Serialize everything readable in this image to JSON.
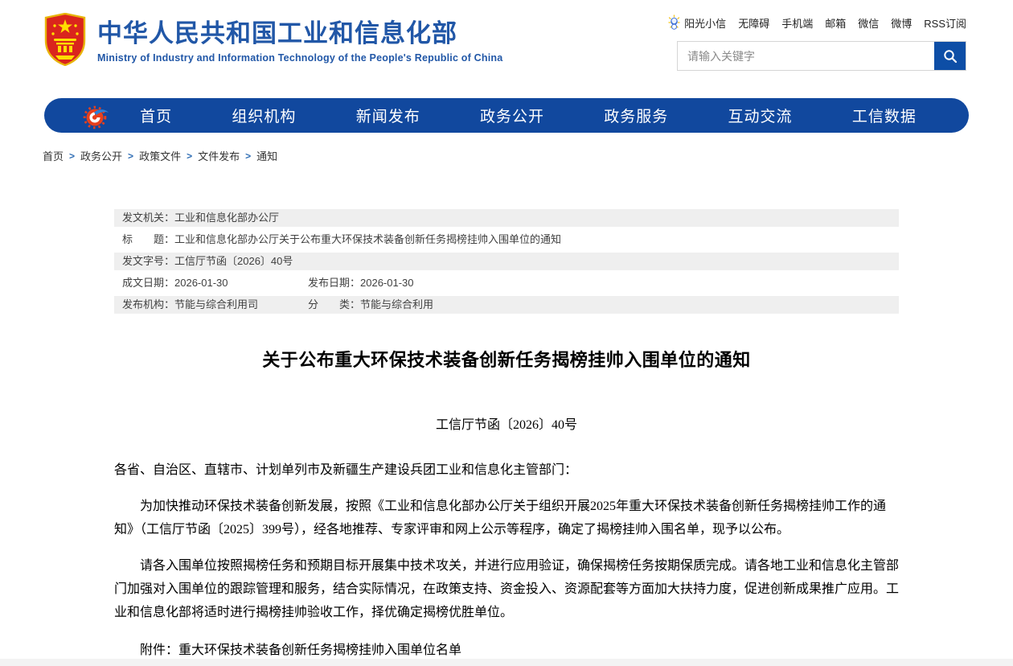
{
  "header": {
    "site_title": "中华人民共和国工业和信息化部",
    "site_subtitle": "Ministry of Industry and Information Technology of the People's Republic of China",
    "top_links": [
      "阳光小信",
      "无障碍",
      "手机端",
      "邮箱",
      "微信",
      "微博",
      "RSS订阅"
    ],
    "search": {
      "placeholder": "请输入关键字"
    }
  },
  "nav": {
    "items": [
      "首页",
      "组织机构",
      "新闻发布",
      "政务公开",
      "政务服务",
      "互动交流",
      "工信数据"
    ]
  },
  "breadcrumb": {
    "separator": ">",
    "items": [
      "首页",
      "政务公开",
      "政策文件",
      "文件发布",
      "通知"
    ]
  },
  "meta_table": {
    "rows": [
      {
        "label1": "发文机关：",
        "value1": "工业和信息化部办公厅",
        "label2": "",
        "value2": ""
      },
      {
        "label1": "标　　题：",
        "value1": "工业和信息化部办公厅关于公布重大环保技术装备创新任务揭榜挂帅入围单位的通知",
        "label2": "",
        "value2": ""
      },
      {
        "label1": "发文字号：",
        "value1": "工信厅节函〔2026〕40号",
        "label2": "",
        "value2": ""
      },
      {
        "label1": "成文日期：",
        "value1": "2026-01-30",
        "label2": "发布日期：",
        "value2": "2026-01-30"
      },
      {
        "label1": "发布机构：",
        "value1": "节能与综合利用司",
        "label2": "分　　类：",
        "value2": "节能与综合利用"
      }
    ]
  },
  "article": {
    "title": "关于公布重大环保技术装备创新任务揭榜挂帅入围单位的通知",
    "doc_number": "工信厅节函〔2026〕40号",
    "salutation": "各省、自治区、直辖市、计划单列市及新疆生产建设兵团工业和信息化主管部门：",
    "paragraph1": "为加快推动环保技术装备创新发展，按照《工业和信息化部办公厅关于组织开展2025年重大环保技术装备创新任务揭榜挂帅工作的通知》（工信厅节函〔2025〕399号），经各地推荐、专家评审和网上公示等程序，确定了揭榜挂帅入围名单，现予以公布。",
    "paragraph2": "请各入围单位按照揭榜任务和预期目标开展集中技术攻关，并进行应用验证，确保揭榜任务按期保质完成。请各地工业和信息化主管部门加强对入围单位的跟踪管理和服务，结合实际情况，在政策支持、资金投入、资源配套等方面加大扶持力度，促进创新成果推广应用。工业和信息化部将适时进行揭榜挂帅验收工作，择优确定揭榜优胜单位。",
    "attachment": "附件：重大环保技术装备创新任务揭榜挂帅入围单位名单"
  },
  "colors": {
    "nav_blue": "#11489E",
    "title_blue": "#2157A7",
    "search_button_blue": "#0D4EA6",
    "row_shade_grey": "#EFEFEF",
    "breadcrumb_separator_blue": "#2E6DB4"
  }
}
